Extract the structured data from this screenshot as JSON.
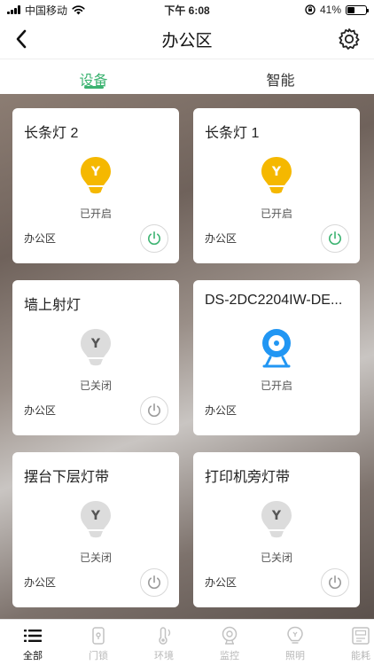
{
  "status_bar": {
    "carrier": "中国移动",
    "time": "下午 6:08",
    "battery": "41%",
    "battery_level": 0.41
  },
  "header": {
    "title": "办公区"
  },
  "tabs": [
    {
      "label": "设备",
      "active": true
    },
    {
      "label": "智能",
      "active": false
    }
  ],
  "devices": [
    {
      "name": "长条灯 2",
      "status": "已开启",
      "room": "办公区",
      "on": true,
      "icon": "bulb-icon"
    },
    {
      "name": "长条灯 1",
      "status": "已开启",
      "room": "办公区",
      "on": true,
      "icon": "bulb-icon"
    },
    {
      "name": "墙上射灯",
      "status": "已关闭",
      "room": "办公区",
      "on": false,
      "icon": "bulb-icon"
    },
    {
      "name": "DS-2DC2204IW-DE...",
      "status": "已开启",
      "room": "办公区",
      "on": true,
      "icon": "camera-icon"
    },
    {
      "name": "摆台下层灯带",
      "status": "已关闭",
      "room": "办公区",
      "on": false,
      "icon": "bulb-icon"
    },
    {
      "name": "打印机旁灯带",
      "status": "已关闭",
      "room": "办公区",
      "on": false,
      "icon": "bulb-icon"
    }
  ],
  "bottom_tabs": [
    {
      "label": "全部",
      "icon": "list-icon",
      "active": true
    },
    {
      "label": "门锁",
      "icon": "lock-icon",
      "active": false
    },
    {
      "label": "环境",
      "icon": "environment-icon",
      "active": false
    },
    {
      "label": "监控",
      "icon": "camera-icon",
      "active": false
    },
    {
      "label": "照明",
      "icon": "bulb-icon",
      "active": false
    },
    {
      "label": "能耗",
      "icon": "meter-icon",
      "active": false
    }
  ],
  "colors": {
    "accent": "#3cb371",
    "bulb_on": "#f5b800",
    "bulb_off": "#d9d9d9",
    "camera": "#2196f3"
  }
}
